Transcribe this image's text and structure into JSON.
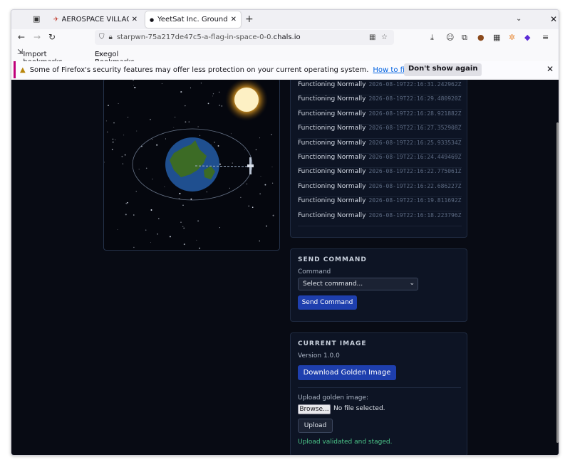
{
  "browser": {
    "tabs": [
      {
        "title": "AEROSPACE VILLAGE S",
        "active": false
      },
      {
        "title": "YeetSat Inc. Ground St",
        "active": true
      }
    ],
    "url_prefix": "starpwn-75a217de47c5-a-flag-in-space-0-0.",
    "url_host": "chals.io",
    "bookmarks": [
      "Import bookmarks...",
      "Exegol Bookmarks"
    ],
    "notification": {
      "text": "Some of Firefox's security features may offer less protection on your current operating system.",
      "link": "How to fix this issue",
      "button": "Don't show again"
    }
  },
  "telemetry_log": [
    {
      "status": "Functioning Normally",
      "time": "2026-08-19T22:16:31.242962Z"
    },
    {
      "status": "Functioning Normally",
      "time": "2026-08-19T22:16:29.480920Z"
    },
    {
      "status": "Functioning Normally",
      "time": "2026-08-19T22:16:28.921882Z"
    },
    {
      "status": "Functioning Normally",
      "time": "2026-08-19T22:16:27.352908Z"
    },
    {
      "status": "Functioning Normally",
      "time": "2026-08-19T22:16:25.933534Z"
    },
    {
      "status": "Functioning Normally",
      "time": "2026-08-19T22:16:24.449469Z"
    },
    {
      "status": "Functioning Normally",
      "time": "2026-08-19T22:16:22.775061Z"
    },
    {
      "status": "Functioning Normally",
      "time": "2026-08-19T22:16:22.686227Z"
    },
    {
      "status": "Functioning Normally",
      "time": "2026-08-19T22:16:19.811692Z"
    },
    {
      "status": "Functioning Normally",
      "time": "2026-08-19T22:16:18.223796Z"
    }
  ],
  "send_command": {
    "title": "SEND COMMAND",
    "label": "Command",
    "selected": "Select command...",
    "button": "Send Command"
  },
  "current_image": {
    "title": "CURRENT IMAGE",
    "version": "Version 1.0.0",
    "download_button": "Download Golden Image",
    "upload_label": "Upload golden image:",
    "browse_button": "Browse...",
    "no_file": "No file selected.",
    "upload_button": "Upload",
    "status": "Upload validated and staged."
  },
  "colors": {
    "accent_button": "#1e3fae",
    "success_text": "#4cc78a",
    "page_bg": "#080b14"
  }
}
